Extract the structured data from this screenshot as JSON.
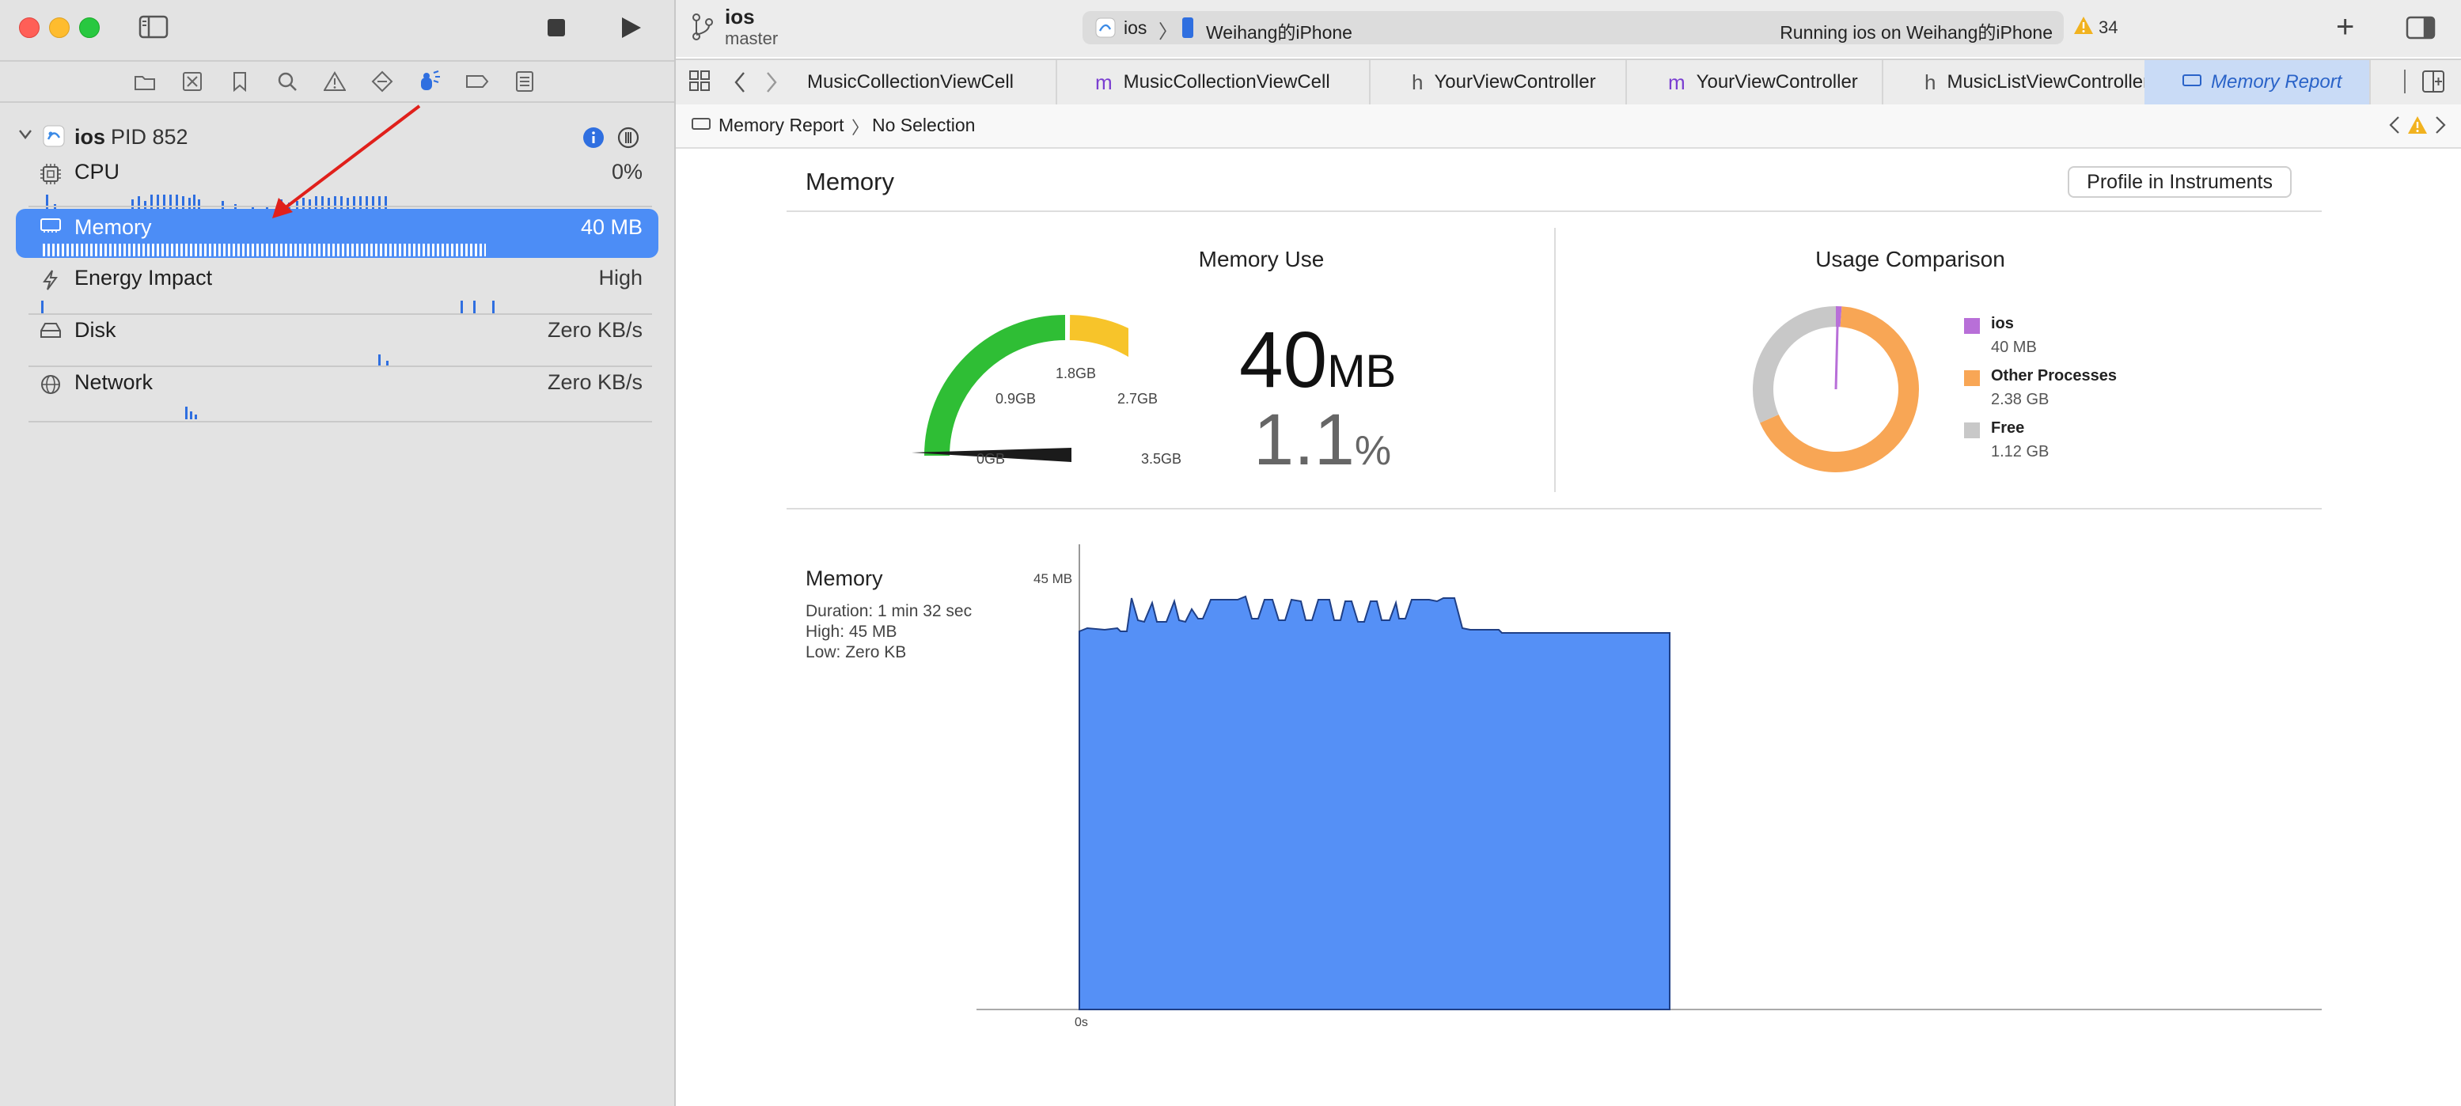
{
  "sidebar": {
    "process": {
      "name": "ios",
      "pid": "PID 852"
    },
    "gauges": [
      {
        "label": "CPU",
        "value": "0%"
      },
      {
        "label": "Memory",
        "value": "40 MB"
      },
      {
        "label": "Energy Impact",
        "value": "High"
      },
      {
        "label": "Disk",
        "value": "Zero KB/s"
      },
      {
        "label": "Network",
        "value": "Zero KB/s"
      }
    ]
  },
  "toolbar": {
    "project": "ios",
    "branch": "master",
    "scheme": "ios",
    "device": "Weihang的iPhone",
    "status": "Running ios on Weihang的iPhone",
    "warning_count": "34"
  },
  "tabs": [
    {
      "glyph": "",
      "label": "MusicCollectionViewCell"
    },
    {
      "glyph": "m",
      "label": "MusicCollectionViewCell"
    },
    {
      "glyph": "h",
      "label": "YourViewController"
    },
    {
      "glyph": "m",
      "label": "YourViewController"
    },
    {
      "glyph": "h",
      "label": "MusicListViewController"
    },
    {
      "glyph": "",
      "label": "Memory Report"
    }
  ],
  "breadcrumb": {
    "item1": "Memory Report",
    "item2": "No Selection"
  },
  "report": {
    "title": "Memory",
    "profile_button": "Profile in Instruments",
    "memory_use": {
      "title": "Memory Use",
      "value": "40",
      "unit": "MB",
      "percent": "1.1",
      "percent_unit": "%",
      "gauge_labels": [
        "0GB",
        "0.9GB",
        "1.8GB",
        "2.7GB",
        "3.5GB"
      ]
    },
    "usage_comparison": {
      "title": "Usage Comparison",
      "items": [
        {
          "name": "ios",
          "value": "40 MB",
          "color": "#b86fd8"
        },
        {
          "name": "Other Processes",
          "value": "2.38 GB",
          "color": "#f8a655"
        },
        {
          "name": "Free",
          "value": "1.12 GB",
          "color": "#c8c8c8"
        }
      ]
    },
    "chart": {
      "title": "Memory",
      "duration": "Duration: 1 min 32 sec",
      "high": "High: 45 MB",
      "low": "Low: Zero KB",
      "y_label": "45 MB",
      "x_label": "0s"
    }
  },
  "colors": {
    "accent": "#4c8df6",
    "fill": "#5590f6"
  }
}
